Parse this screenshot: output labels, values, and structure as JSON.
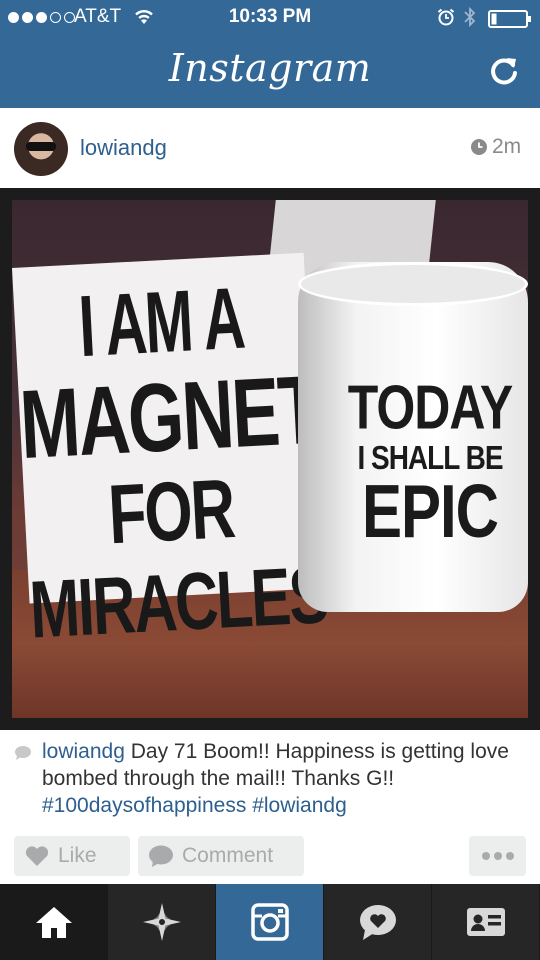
{
  "status_bar": {
    "carrier": "AT&T",
    "time": "10:33 PM",
    "signal_bars_filled": 3,
    "signal_bars_total": 5
  },
  "nav": {
    "title": "Instagram"
  },
  "post": {
    "username": "lowiandg",
    "time_ago": "2m",
    "photo": {
      "card_lines": [
        "I AM A",
        "MAGNET",
        "FOR",
        "MIRACLES"
      ],
      "mug_lines": [
        "TODAY",
        "I SHALL BE",
        "EPIC"
      ]
    },
    "caption": {
      "username": "lowiandg",
      "text": "Day 71 Boom!! Happiness is getting love bombed through the mail!! Thanks G!!",
      "hashtag_1": "#100daysofhappiness",
      "hashtag_2": "#lowiandg"
    },
    "actions": {
      "like_label": "Like",
      "comment_label": "Comment"
    }
  },
  "tab_bar": {
    "items": [
      "home-icon",
      "explore-icon",
      "camera-icon",
      "news-icon",
      "profile-icon"
    ],
    "active": "home-icon",
    "highlight": "camera-icon"
  },
  "colors": {
    "brand_blue": "#346897",
    "link_blue": "#2d5f8f",
    "tab_bar": "#262626"
  }
}
